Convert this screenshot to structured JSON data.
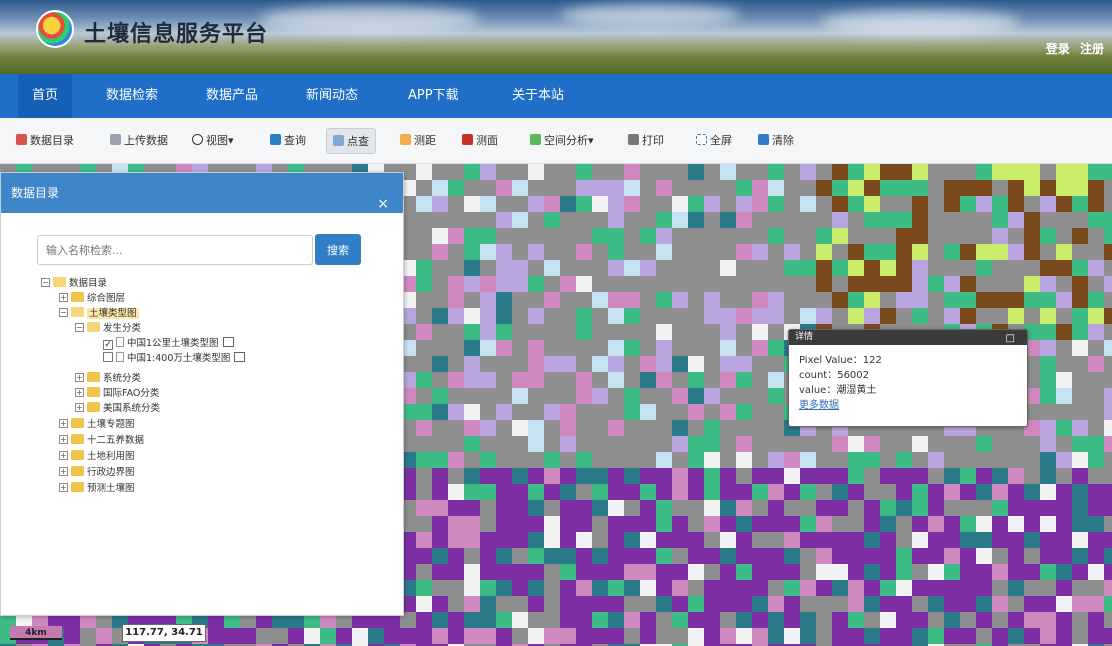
{
  "header": {
    "site_title": "土壤信息服务平台",
    "login": "登录",
    "register": "注册"
  },
  "nav": {
    "items": [
      {
        "label": "首页"
      },
      {
        "label": "数据检索"
      },
      {
        "label": "数据产品"
      },
      {
        "label": "新闻动态"
      },
      {
        "label": "APP下载"
      },
      {
        "label": "关于本站"
      }
    ]
  },
  "toolbar": {
    "items": [
      {
        "label": "数据目录",
        "icon": "catalog-icon"
      },
      {
        "label": "上传数据",
        "icon": "upload-icon"
      },
      {
        "label": "视图▾",
        "icon": "view-icon"
      },
      {
        "label": "查询",
        "icon": "query-icon"
      },
      {
        "label": "点查",
        "icon": "point-query-icon"
      },
      {
        "label": "测距",
        "icon": "ruler-icon"
      },
      {
        "label": "测面",
        "icon": "area-icon"
      },
      {
        "label": "空间分析▾",
        "icon": "spatial-analysis-icon"
      },
      {
        "label": "打印",
        "icon": "print-icon"
      },
      {
        "label": "全屏",
        "icon": "fullscreen-icon"
      },
      {
        "label": "清除",
        "icon": "clear-icon"
      }
    ]
  },
  "panel": {
    "title": "数据目录",
    "close": "×",
    "search_placeholder": "输入名称检索...",
    "search_button": "搜索"
  },
  "tree": {
    "root": "数据目录",
    "n1": "综合图层",
    "n2": "土壤类型图",
    "n3": "发生分类",
    "n4": "中国1公里土壤类型图",
    "n5": "中国1:400万土壤类型图",
    "n6": "系统分类",
    "n7": "国际FAO分类",
    "n8": "美国系统分类",
    "n9": "土壤专题图",
    "n10": "十二五养数据",
    "n11": "土地利用图",
    "n12": "行政边界图",
    "n13": "预测土壤图"
  },
  "popup": {
    "title": "详情",
    "max_icon": "□",
    "pixel_value": "Pixel Value：122",
    "count": "count：56002",
    "value": "value：潮湿黄土",
    "link": "更多数据"
  },
  "map": {
    "scale_label": "4km",
    "coords": "117.77, 34.71"
  },
  "colors": {
    "nav_bg": "#1f6fc9",
    "panel_header": "#3e86c9",
    "soil_gray": "#8e8e8e",
    "soil_purple": "#7b2fa3",
    "soil_lavender": "#b9a6de",
    "soil_green": "#3dbb84",
    "soil_pink": "#cf89c0",
    "soil_teal": "#2b7a8a",
    "soil_brown": "#7a4a1e",
    "soil_lightblue": "#c7e3f2",
    "soil_lime": "#c9ec6a"
  }
}
